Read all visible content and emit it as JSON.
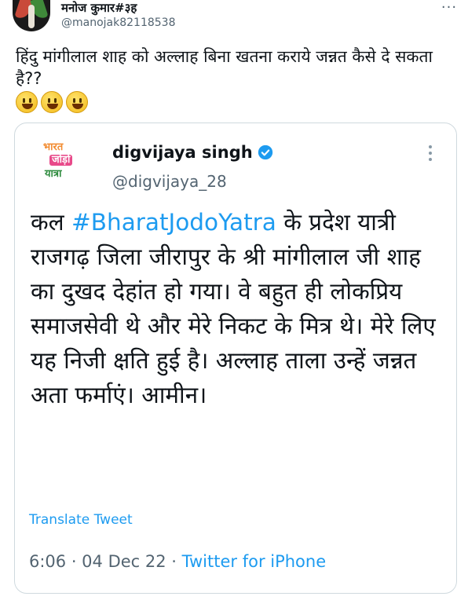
{
  "tweet": {
    "author_name": "मनोज कुमार#३ह",
    "author_handle": "@manojak82118538",
    "text": "हिंदु मांगीलाल शाह को अल्लाह बिना खतना कराये जन्नत कैसे दे सकता है??",
    "emojis": [
      "grinning-face-emoji",
      "grinning-face-emoji",
      "grinning-face-emoji"
    ],
    "more_label": "···"
  },
  "quoted": {
    "author_name": "digvijaya singh",
    "author_handle": "@digvijaya_28",
    "avatar_text": [
      "भारत",
      "जोड़ो",
      "यात्रा"
    ],
    "body_before": "कल ",
    "hashtag": "#BharatJodoYatra",
    "body_after": " के प्रदेश यात्री राजगढ़ जिला जीरापुर के श्री मांगीलाल जी शाह का दुखद देहांत हो गया। वे बहुत ही लोकप्रिय समाजसेवी थे और मेरे निकट के मित्र थे। मेरे लिए यह निजी क्षति हुई है। अल्लाह ताला उन्हें जन्नत अता फर्माएं। आमीन।",
    "translate_label": "Translate Tweet",
    "timestamp": "6:06 · 04 Dec 22 · ",
    "source": "Twitter for iPhone"
  },
  "colors": {
    "link_blue": "#1d9bf0",
    "secondary_text": "#536471",
    "border": "#cfd9de"
  }
}
